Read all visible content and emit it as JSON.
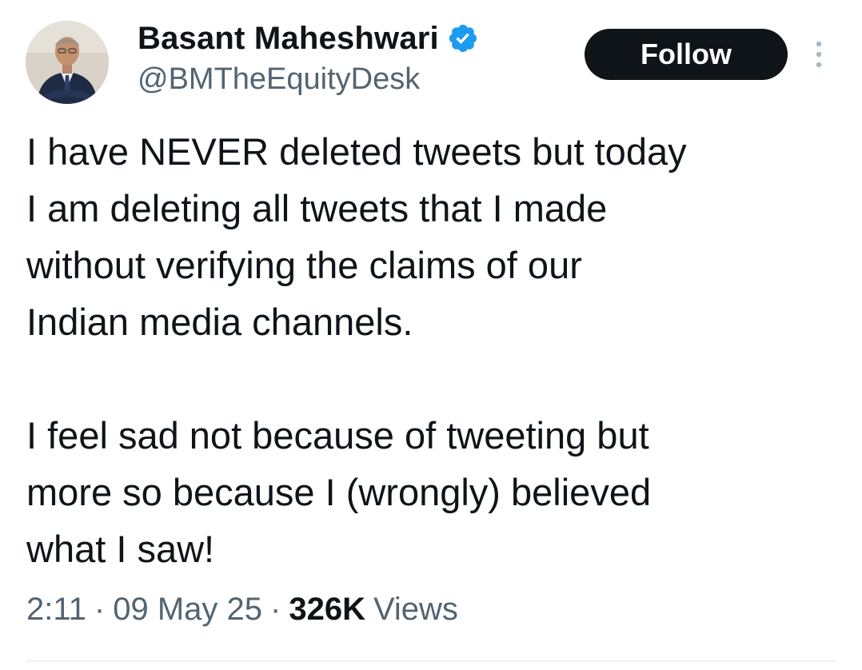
{
  "author": {
    "display_name": "Basant Maheshwari",
    "handle": "@BMTheEquityDesk",
    "verified": true,
    "avatar_icon": "profile-photo"
  },
  "actions": {
    "follow_label": "Follow",
    "more_icon": "more-options-icon"
  },
  "tweet": {
    "paragraphs": [
      "I have NEVER deleted tweets but today\nI am deleting all tweets that I made\nwithout verifying the claims of our\nIndian media channels.",
      "I feel sad not because of tweeting but\nmore so because I (wrongly) believed\nwhat I saw!"
    ]
  },
  "meta": {
    "time": "2:11",
    "separator": "·",
    "date": "09 May 25",
    "views_count": "326K",
    "views_label": "Views"
  },
  "colors": {
    "text_primary": "#0f1419",
    "text_secondary": "#536471",
    "verified_blue": "#1d9bf0",
    "follow_bg": "#0f1419",
    "follow_text": "#ffffff"
  }
}
